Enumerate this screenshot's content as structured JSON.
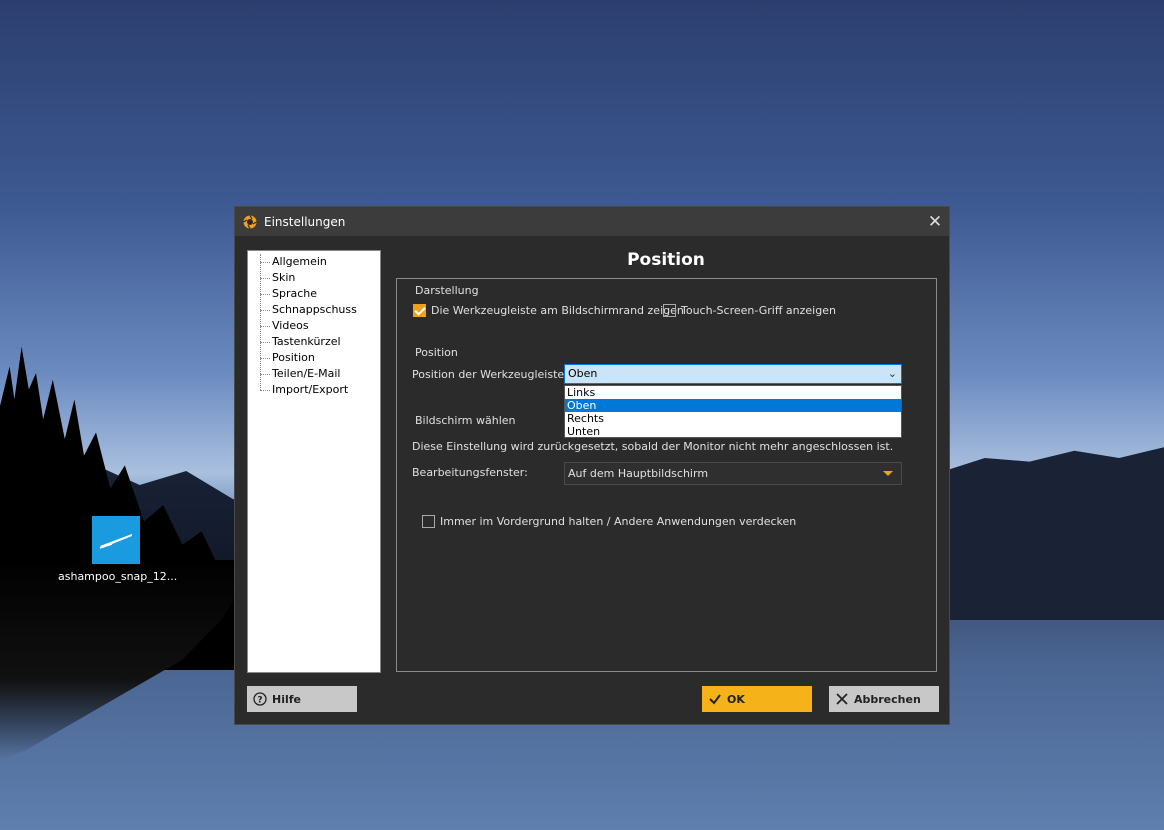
{
  "desktop": {
    "icon_label": "ashampoo_snap_12..."
  },
  "dialog": {
    "title": "Einstellungen",
    "close_glyph": "✕",
    "nav": [
      "Allgemein",
      "Skin",
      "Sprache",
      "Schnappschuss",
      "Videos",
      "Tastenkürzel",
      "Position",
      "Teilen/E-Mail",
      "Import/Export"
    ],
    "page_title": "Position",
    "darstellung": {
      "heading": "Darstellung",
      "toolbar_checkbox_label": "Die Werkzeugleiste am Bildschirmrand zeigen",
      "toolbar_checkbox_checked": true,
      "touch_checkbox_label": "Touch-Screen-Griff anzeigen",
      "touch_checkbox_checked": false
    },
    "position": {
      "heading": "Position",
      "field_label": "Position der Werkzeugleiste:",
      "selected": "Oben",
      "options": [
        "Links",
        "Oben",
        "Rechts",
        "Unten"
      ]
    },
    "bildschirm": {
      "heading": "Bildschirm wählen",
      "note": "Diese Einstellung wird zurückgesetzt, sobald der Monitor nicht mehr angeschlossen ist.",
      "field_label": "Bearbeitungsfenster:",
      "selected": "Auf dem Hauptbildschirm"
    },
    "foreground_checkbox_label": "Immer im Vordergrund halten / Andere Anwendungen verdecken",
    "foreground_checkbox_checked": false,
    "buttons": {
      "help": "Hilfe",
      "ok": "OK",
      "cancel": "Abbrechen"
    }
  },
  "colors": {
    "accent": "#f5b319",
    "selection": "#0078d7",
    "dialog_bg": "#2b2b2b"
  }
}
